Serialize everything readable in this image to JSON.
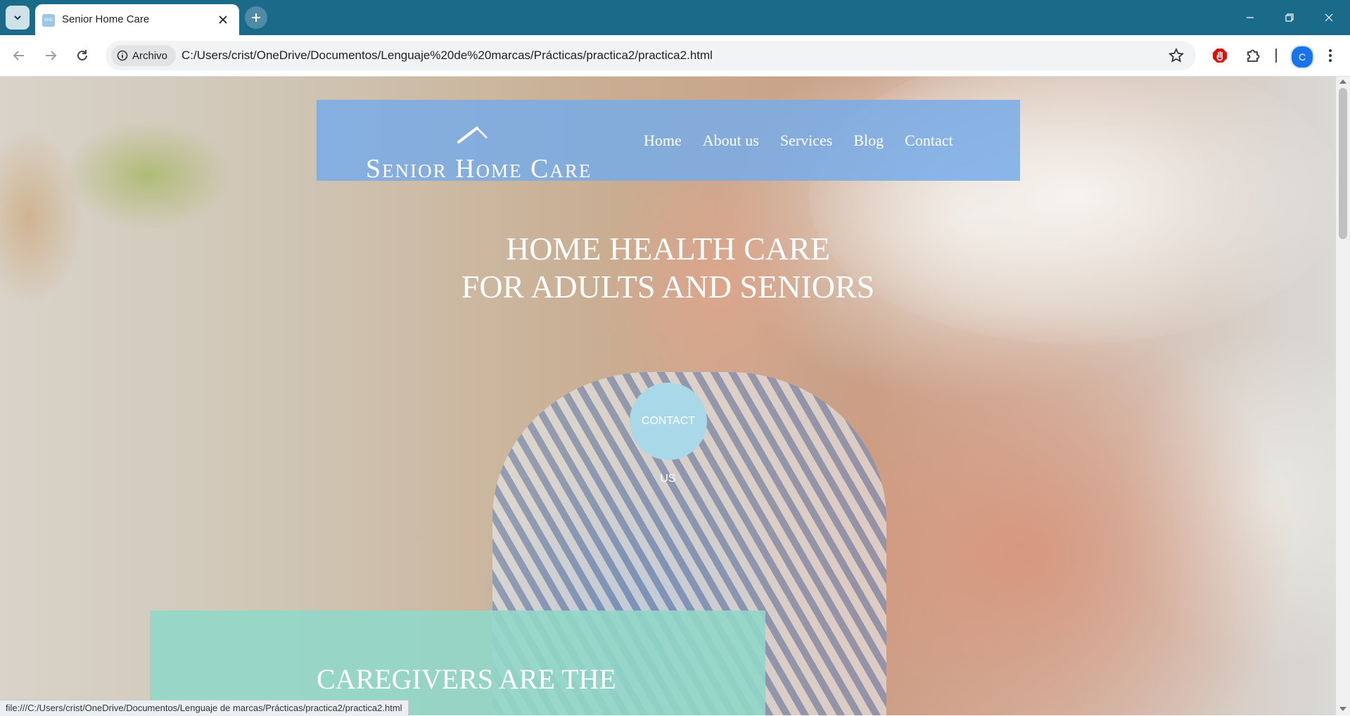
{
  "browser": {
    "tab_title": "Senior Home Care",
    "favicon_text": "SHC",
    "url_chip": "Archivo",
    "url": "C:/Users/crist/OneDrive/Documentos/Lenguaje%20de%20marcas/Prácticas/practica2/practica2.html",
    "profile_initial": "C",
    "status_url": "file:///C:/Users/crist/OneDrive/Documentos/Lenguaje de marcas/Prácticas/practica2/practica2.html",
    "accent_color": "#1a6a8a"
  },
  "site": {
    "logo_text": "Senior Home Care",
    "nav": [
      {
        "label": "Home"
      },
      {
        "label": "About us"
      },
      {
        "label": "Services"
      },
      {
        "label": "Blog"
      },
      {
        "label": "Contact"
      }
    ],
    "hero": {
      "line1": "HOME HEALTH CARE",
      "line2": "FOR ADULTS AND SENIORS",
      "button_label": "CONTACT",
      "button_overflow": "US"
    },
    "caregivers_title": "CAREGIVERS ARE THE",
    "colors": {
      "navbar": "#78ace8",
      "contact_button": "#a9d9e8",
      "caregivers_box": "#91d7c8"
    }
  }
}
